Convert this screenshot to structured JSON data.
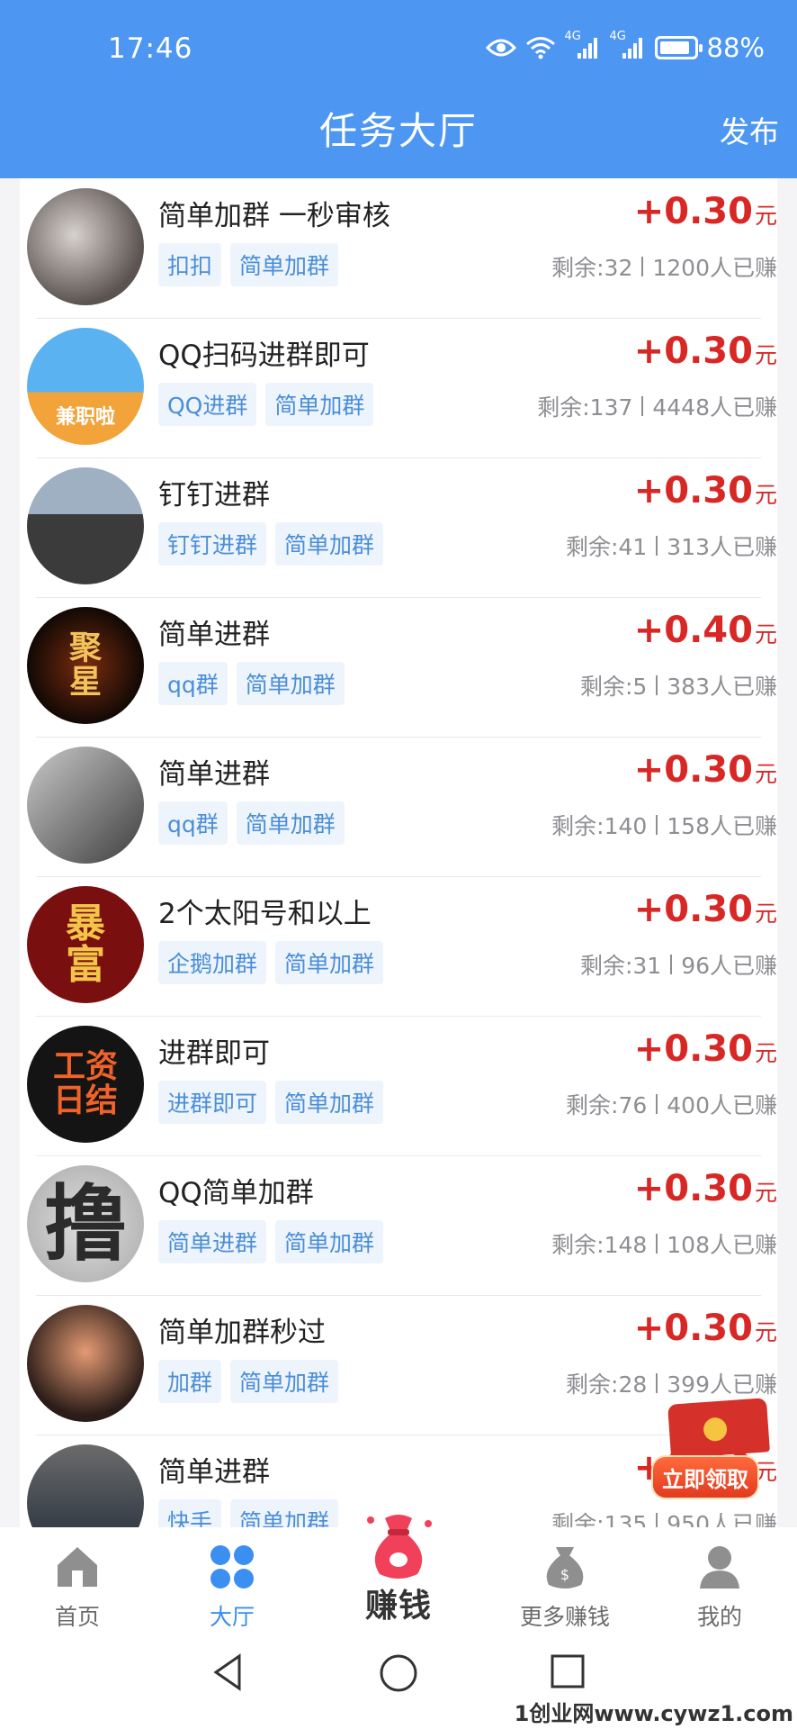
{
  "status_bar": {
    "time": "17:46",
    "network1": "4G",
    "network2": "4G",
    "battery": "88%",
    "battery_level": 0.88
  },
  "header": {
    "title": "任务大厅",
    "publish": "发布"
  },
  "tasks": [
    {
      "title": "简单加群 一秒审核",
      "tags": [
        "扣扣",
        "简单加群"
      ],
      "reward": "+0.30",
      "unit": "元",
      "remaining": "剩余:32",
      "earned": "1200人已赚"
    },
    {
      "title": "QQ扫码进群即可",
      "tags": [
        "QQ进群",
        "简单加群"
      ],
      "reward": "+0.30",
      "unit": "元",
      "remaining": "剩余:137",
      "earned": "4448人已赚",
      "avatar_text": "兼职啦"
    },
    {
      "title": "钉钉进群",
      "tags": [
        "钉钉进群",
        "简单加群"
      ],
      "reward": "+0.30",
      "unit": "元",
      "remaining": "剩余:41",
      "earned": "313人已赚"
    },
    {
      "title": "简单进群",
      "tags": [
        "qq群",
        "简单加群"
      ],
      "reward": "+0.40",
      "unit": "元",
      "remaining": "剩余:5",
      "earned": "383人已赚",
      "avatar_text": "聚星"
    },
    {
      "title": "简单进群",
      "tags": [
        "qq群",
        "简单加群"
      ],
      "reward": "+0.30",
      "unit": "元",
      "remaining": "剩余:140",
      "earned": "158人已赚"
    },
    {
      "title": "2个太阳号和以上",
      "tags": [
        "企鹅加群",
        "简单加群"
      ],
      "reward": "+0.30",
      "unit": "元",
      "remaining": "剩余:31",
      "earned": "96人已赚",
      "avatar_text": "暴富"
    },
    {
      "title": "进群即可",
      "tags": [
        "进群即可",
        "简单加群"
      ],
      "reward": "+0.30",
      "unit": "元",
      "remaining": "剩余:76",
      "earned": "400人已赚",
      "avatar_text": "工资日结"
    },
    {
      "title": "QQ简单加群",
      "tags": [
        "简单进群",
        "简单加群"
      ],
      "reward": "+0.30",
      "unit": "元",
      "remaining": "剩余:148",
      "earned": "108人已赚",
      "avatar_text": "撸"
    },
    {
      "title": "简单加群秒过",
      "tags": [
        "加群",
        "简单加群"
      ],
      "reward": "+0.30",
      "unit": "元",
      "remaining": "剩余:28",
      "earned": "399人已赚"
    },
    {
      "title": "简单进群",
      "tags": [
        "快手",
        "简单加群"
      ],
      "reward": "+0.30",
      "unit": "元",
      "remaining": "剩余:135",
      "earned": "950人已赚"
    }
  ],
  "float_button": {
    "label": "立即领取"
  },
  "tabbar": {
    "home": "首页",
    "hall": "大厅",
    "earn": "赚钱",
    "more": "更多赚钱",
    "mine": "我的"
  },
  "watermark": "1创业网www.cywz1.com",
  "colors": {
    "header_bg": "#4d97f2",
    "reward_red": "#d82826",
    "tag_blue": "#4a8ed9",
    "tab_active": "#3a8ff0"
  },
  "icons": {
    "eye": "eye-icon",
    "wifi": "wifi-icon",
    "signal": "signal-icon",
    "home": "home-icon",
    "hall": "grid-icon",
    "earn": "money-bag-icon",
    "more": "coin-bag-icon",
    "mine": "user-icon"
  }
}
